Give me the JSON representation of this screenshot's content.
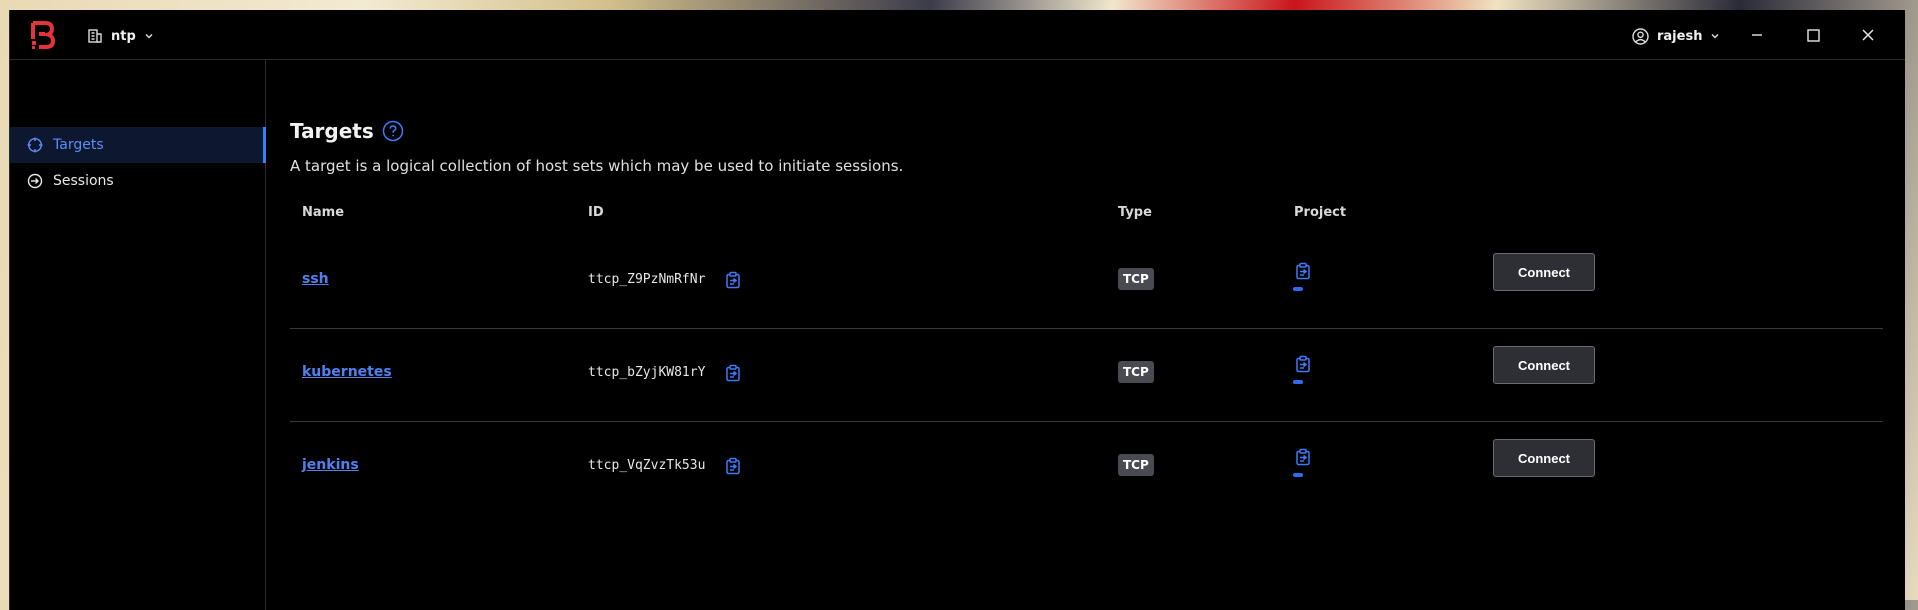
{
  "app": {
    "org_name": "ntp",
    "user_name": "rajesh"
  },
  "sidebar": {
    "items": [
      {
        "label": "Targets",
        "icon": "target-icon",
        "active": true
      },
      {
        "label": "Sessions",
        "icon": "session-icon",
        "active": false
      }
    ]
  },
  "page": {
    "title": "Targets",
    "description": "A target is a logical collection of host sets which may be used to initiate sessions."
  },
  "table": {
    "columns": [
      "Name",
      "ID",
      "Type",
      "Project"
    ],
    "rows": [
      {
        "name": "ssh",
        "id": "ttcp_Z9PzNmRfNr",
        "type": "TCP",
        "action": "Connect"
      },
      {
        "name": "kubernetes",
        "id": "ttcp_bZyjKW81rY",
        "type": "TCP",
        "action": "Connect"
      },
      {
        "name": "jenkins",
        "id": "ttcp_VqZvzTk53u",
        "type": "TCP",
        "action": "Connect"
      }
    ]
  },
  "colors": {
    "accent": "#3e7bfa",
    "logo": "#e2343a",
    "background": "#000000",
    "badge": "#4a4b52"
  }
}
